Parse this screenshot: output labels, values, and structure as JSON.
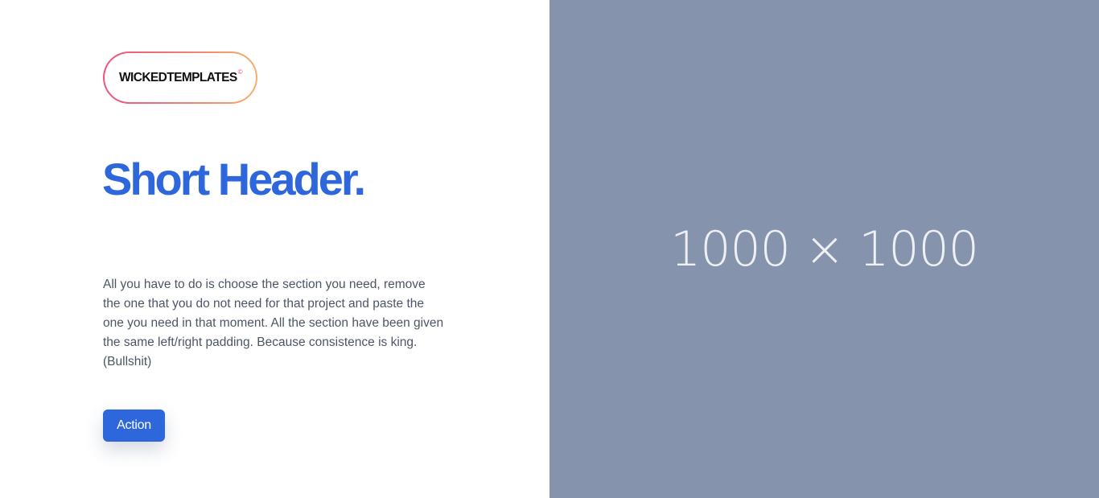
{
  "logo": {
    "text": "WICKEDTEMPLATES",
    "mark": "©"
  },
  "hero": {
    "headline": "Short Header.",
    "body": "All you have to do is choose the section you need, remove the one that you do not need for that project and paste the one you need in that moment. All the section have been given the same left/right padding. Because consistence is king. (Bullshit)",
    "action_label": "Action"
  },
  "image_placeholder": {
    "label": "1000 × 1000"
  },
  "colors": {
    "accent": "#2e66dc",
    "placeholder_bg": "#8693ac",
    "logo_gradient_start": "#e8557f",
    "logo_gradient_end": "#f5b06a",
    "body_text": "#4c5566"
  }
}
